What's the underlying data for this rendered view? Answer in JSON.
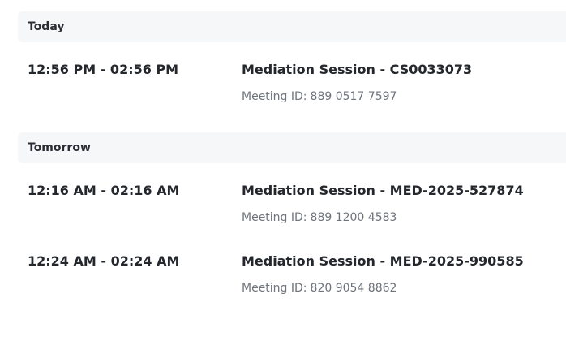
{
  "schedule": {
    "groups": [
      {
        "label": "Today",
        "meetings": [
          {
            "time": "12:56 PM - 02:56 PM",
            "title": "Mediation Session - CS0033073",
            "meeting_id_label": "Meeting ID:",
            "meeting_id": "889 0517 7597"
          }
        ]
      },
      {
        "label": "Tomorrow",
        "meetings": [
          {
            "time": "12:16 AM - 02:16 AM",
            "title": "Mediation Session - MED-2025-527874",
            "meeting_id_label": "Meeting ID:",
            "meeting_id": "889 1200 4583"
          },
          {
            "time": "12:24 AM - 02:24 AM",
            "title": "Mediation Session - MED-2025-990585",
            "meeting_id_label": "Meeting ID:",
            "meeting_id": "820 9054 8862"
          }
        ]
      }
    ]
  }
}
